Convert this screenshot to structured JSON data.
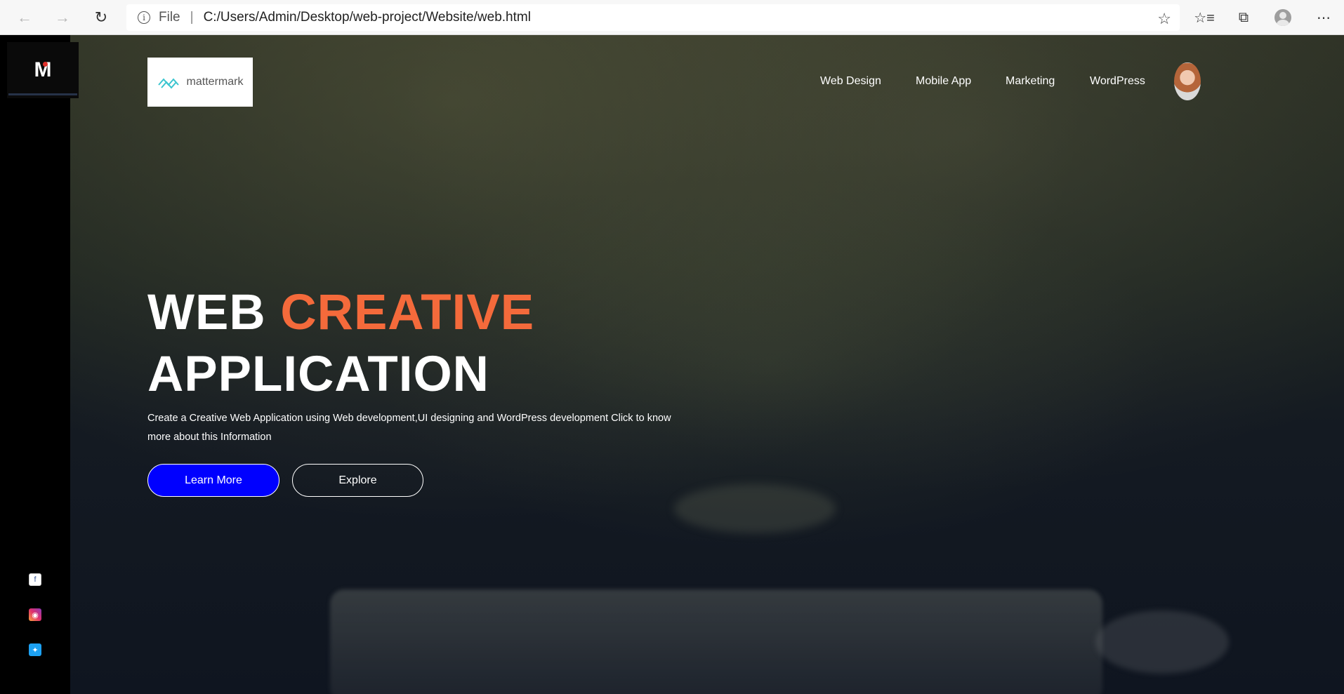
{
  "browser": {
    "back_icon": "arrow-left-icon",
    "forward_icon": "arrow-right-icon",
    "refresh_icon": "refresh-icon",
    "scheme": "File",
    "url": "C:/Users/Admin/Desktop/web-project/Website/web.html",
    "favorite_icon": "star-icon",
    "favorites_icon": "favorites-list-icon",
    "collections_icon": "collections-icon",
    "profile_icon": "profile-icon",
    "menu_icon": "more-icon"
  },
  "sidebar": {
    "logo_text": "M",
    "social": [
      "facebook-icon",
      "instagram-icon",
      "twitter-icon"
    ]
  },
  "header": {
    "brand": "mattermark",
    "nav": [
      "Web Design",
      "Mobile App",
      "Marketing",
      "WordPress"
    ]
  },
  "hero": {
    "title_part1": "WEB",
    "title_accent": "CREATIVE",
    "title_part2": "APPLICATION",
    "description": "Create a Creative Web Application using Web development,UI designing and WordPress development Click to know more about this Information",
    "learn_more": "Learn More",
    "explore": "Explore"
  },
  "colors": {
    "accent": "#f46a3b",
    "primary_button": "#0000ff",
    "sidebar": "#000000"
  }
}
